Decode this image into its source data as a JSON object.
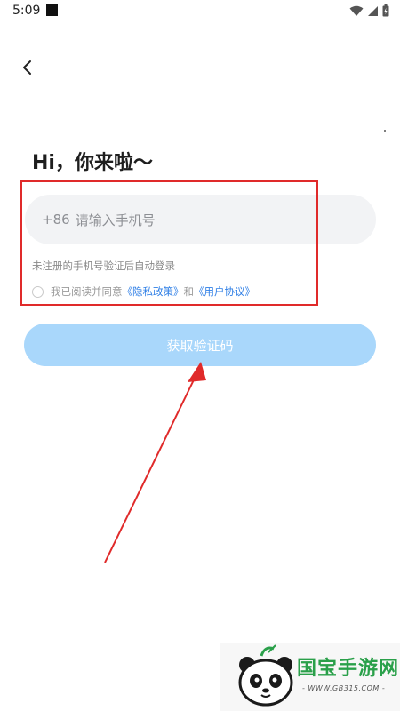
{
  "status_bar": {
    "time": "5:09",
    "icons": [
      "wifi-icon",
      "signal-icon",
      "battery-icon"
    ]
  },
  "header": {
    "back_icon": "chevron-left-icon"
  },
  "login": {
    "greeting": "Hi，你来啦～",
    "phone_prefix": "+86",
    "phone_placeholder": "请输入手机号",
    "hint": "未注册的手机号验证后自动登录",
    "agreement": {
      "prefix": "我已阅读并同意",
      "privacy_link": "《隐私政策》",
      "conjunction": "和",
      "terms_link": "《用户协议》"
    },
    "get_code_label": "获取验证码"
  },
  "watermark": {
    "title": "国宝手游网",
    "url": "- WWW.GB315.COM -"
  },
  "colors": {
    "accent_link": "#2f7fe6",
    "button_disabled": "#a9d7fb",
    "annotation_red": "#e02a2a",
    "input_bg": "#f2f3f5"
  }
}
